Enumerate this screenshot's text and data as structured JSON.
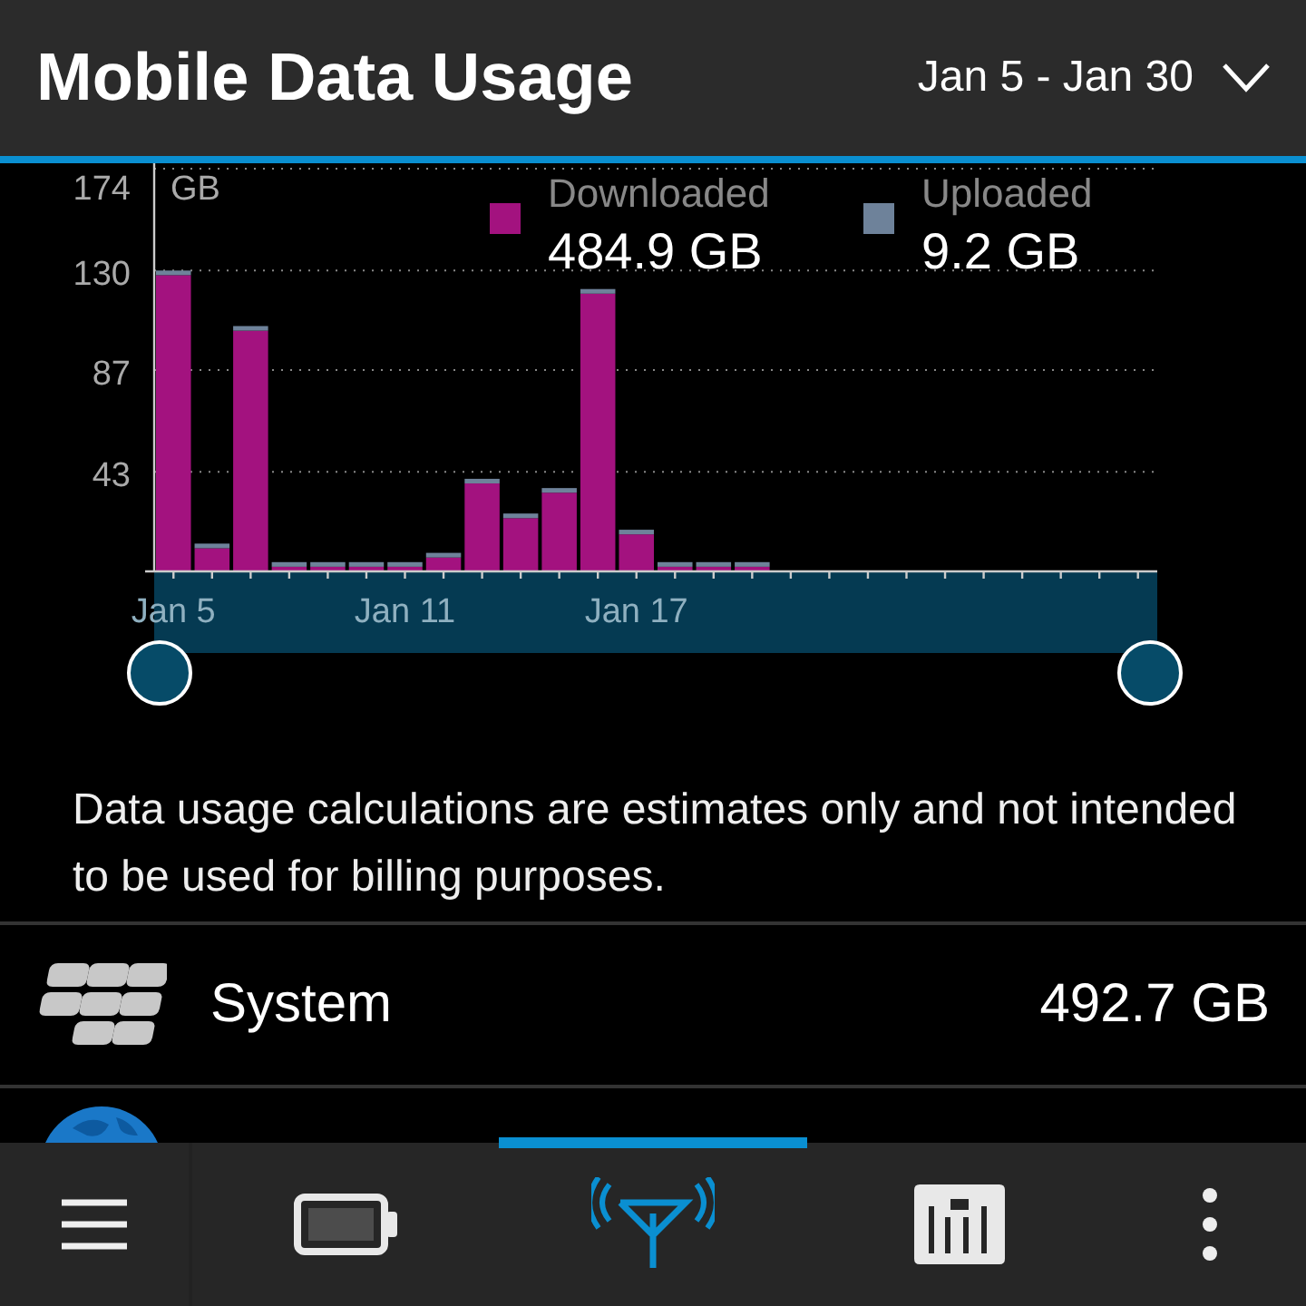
{
  "header": {
    "title": "Mobile Data Usage",
    "date_range": "Jan 5 - Jan 30"
  },
  "usage_chart": {
    "legend_totals": [
      {
        "total": "484.9 GB"
      },
      {
        "total": "9.2 GB"
      }
    ],
    "chart_data": {
      "type": "bar",
      "stacked": true,
      "grid": true,
      "legend": "top",
      "ylabel": "GB",
      "ylim": [
        0,
        174
      ],
      "yticks": [
        43,
        87,
        130,
        174
      ],
      "categories": [
        "Jan 5",
        null,
        null,
        null,
        null,
        null,
        "Jan 11",
        null,
        null,
        null,
        null,
        null,
        "Jan 17",
        null,
        null,
        null,
        null,
        null,
        null,
        null,
        null,
        null,
        null,
        null,
        null,
        null
      ],
      "series": [
        {
          "name": "Downloaded",
          "color": "#a3127f",
          "values": [
            128,
            10,
            104,
            2,
            2,
            2,
            2,
            6,
            38,
            23,
            34,
            120,
            16,
            2,
            2,
            2,
            null,
            null,
            null,
            null,
            null,
            null,
            null,
            null,
            null,
            null
          ]
        },
        {
          "name": "Uploaded",
          "color": "#6e829a",
          "values": [
            2,
            2,
            2,
            2,
            2,
            2,
            2,
            2,
            2,
            2,
            2,
            2,
            2,
            2,
            2,
            2,
            null,
            null,
            null,
            null,
            null,
            null,
            null,
            null,
            null,
            null
          ]
        }
      ]
    }
  },
  "note": "Data usage calculations are estimates only and not intended to be used for billing purposes.",
  "apps": [
    {
      "kind": "system",
      "name": "System",
      "usage": "492.7 GB"
    },
    {
      "kind": "globe"
    }
  ],
  "bottom_bar": {
    "tabs": [
      {
        "kind": "battery",
        "selected": false
      },
      {
        "kind": "network",
        "selected": true
      },
      {
        "kind": "monitor",
        "selected": false
      }
    ]
  }
}
